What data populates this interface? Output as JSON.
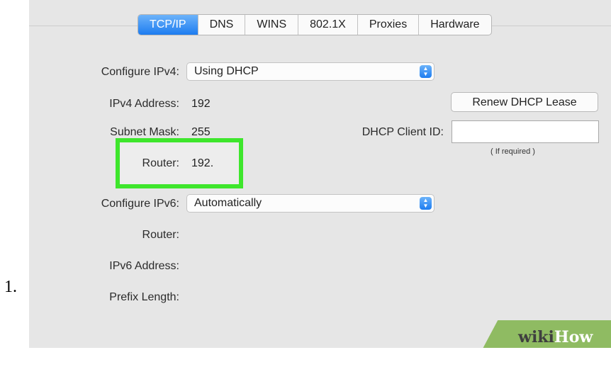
{
  "list_number": "1.",
  "tabs": [
    {
      "label": "TCP/IP",
      "active": true
    },
    {
      "label": "DNS",
      "active": false
    },
    {
      "label": "WINS",
      "active": false
    },
    {
      "label": "802.1X",
      "active": false
    },
    {
      "label": "Proxies",
      "active": false
    },
    {
      "label": "Hardware",
      "active": false
    }
  ],
  "ipv4": {
    "configure_label": "Configure IPv4:",
    "configure_value": "Using DHCP",
    "address_label": "IPv4 Address:",
    "address_value": "192",
    "subnet_label": "Subnet Mask:",
    "subnet_value": "255",
    "router_label": "Router:",
    "router_value": "192."
  },
  "dhcp": {
    "renew_button": "Renew DHCP Lease",
    "client_id_label": "DHCP Client ID:",
    "client_id_value": "",
    "client_id_hint": "( If required )"
  },
  "ipv6": {
    "configure_label": "Configure IPv6:",
    "configure_value": "Automatically",
    "router_label": "Router:",
    "address_label": "IPv6 Address:",
    "prefix_label": "Prefix Length:"
  },
  "watermark": {
    "wiki": "wiki",
    "how": "How"
  },
  "colors": {
    "accent": "#1d7cf0",
    "highlight": "#3ee62c",
    "watermark_bg": "#8fbb62"
  },
  "icons": {
    "popup_arrows": "up-down-chevron-icon"
  }
}
